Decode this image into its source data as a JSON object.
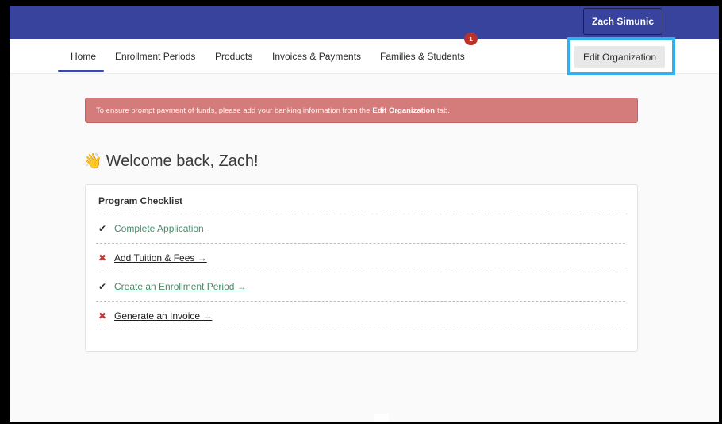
{
  "header": {
    "user_name": "Zach Simunic"
  },
  "nav": {
    "tabs": [
      {
        "label": "Home"
      },
      {
        "label": "Enrollment Periods"
      },
      {
        "label": "Products"
      },
      {
        "label": "Invoices & Payments"
      },
      {
        "label": "Families & Students"
      }
    ],
    "badge_count": "1",
    "edit_org_label": "Edit Organization"
  },
  "alert": {
    "text_before": "To ensure prompt payment of funds, please add your banking information from the",
    "link_text": "Edit Organization",
    "text_after": "tab.",
    "color": "#d47b7b"
  },
  "welcome": {
    "emoji": "👋",
    "text": "Welcome back, Zach!"
  },
  "checklist": {
    "title": "Program Checklist",
    "items": [
      {
        "mark": "✔",
        "label": "Complete Application",
        "status": "done"
      },
      {
        "mark": "✖",
        "label": "Add Tuition & Fees →",
        "status": "todo"
      },
      {
        "mark": "✔",
        "label": "Create an Enrollment Period →",
        "status": "done"
      },
      {
        "mark": "✖",
        "label": "Generate an Invoice →",
        "status": "todo"
      }
    ]
  },
  "colors": {
    "brand": "#38439d",
    "highlight": "#2eb0f1",
    "badge": "#b9312b"
  }
}
